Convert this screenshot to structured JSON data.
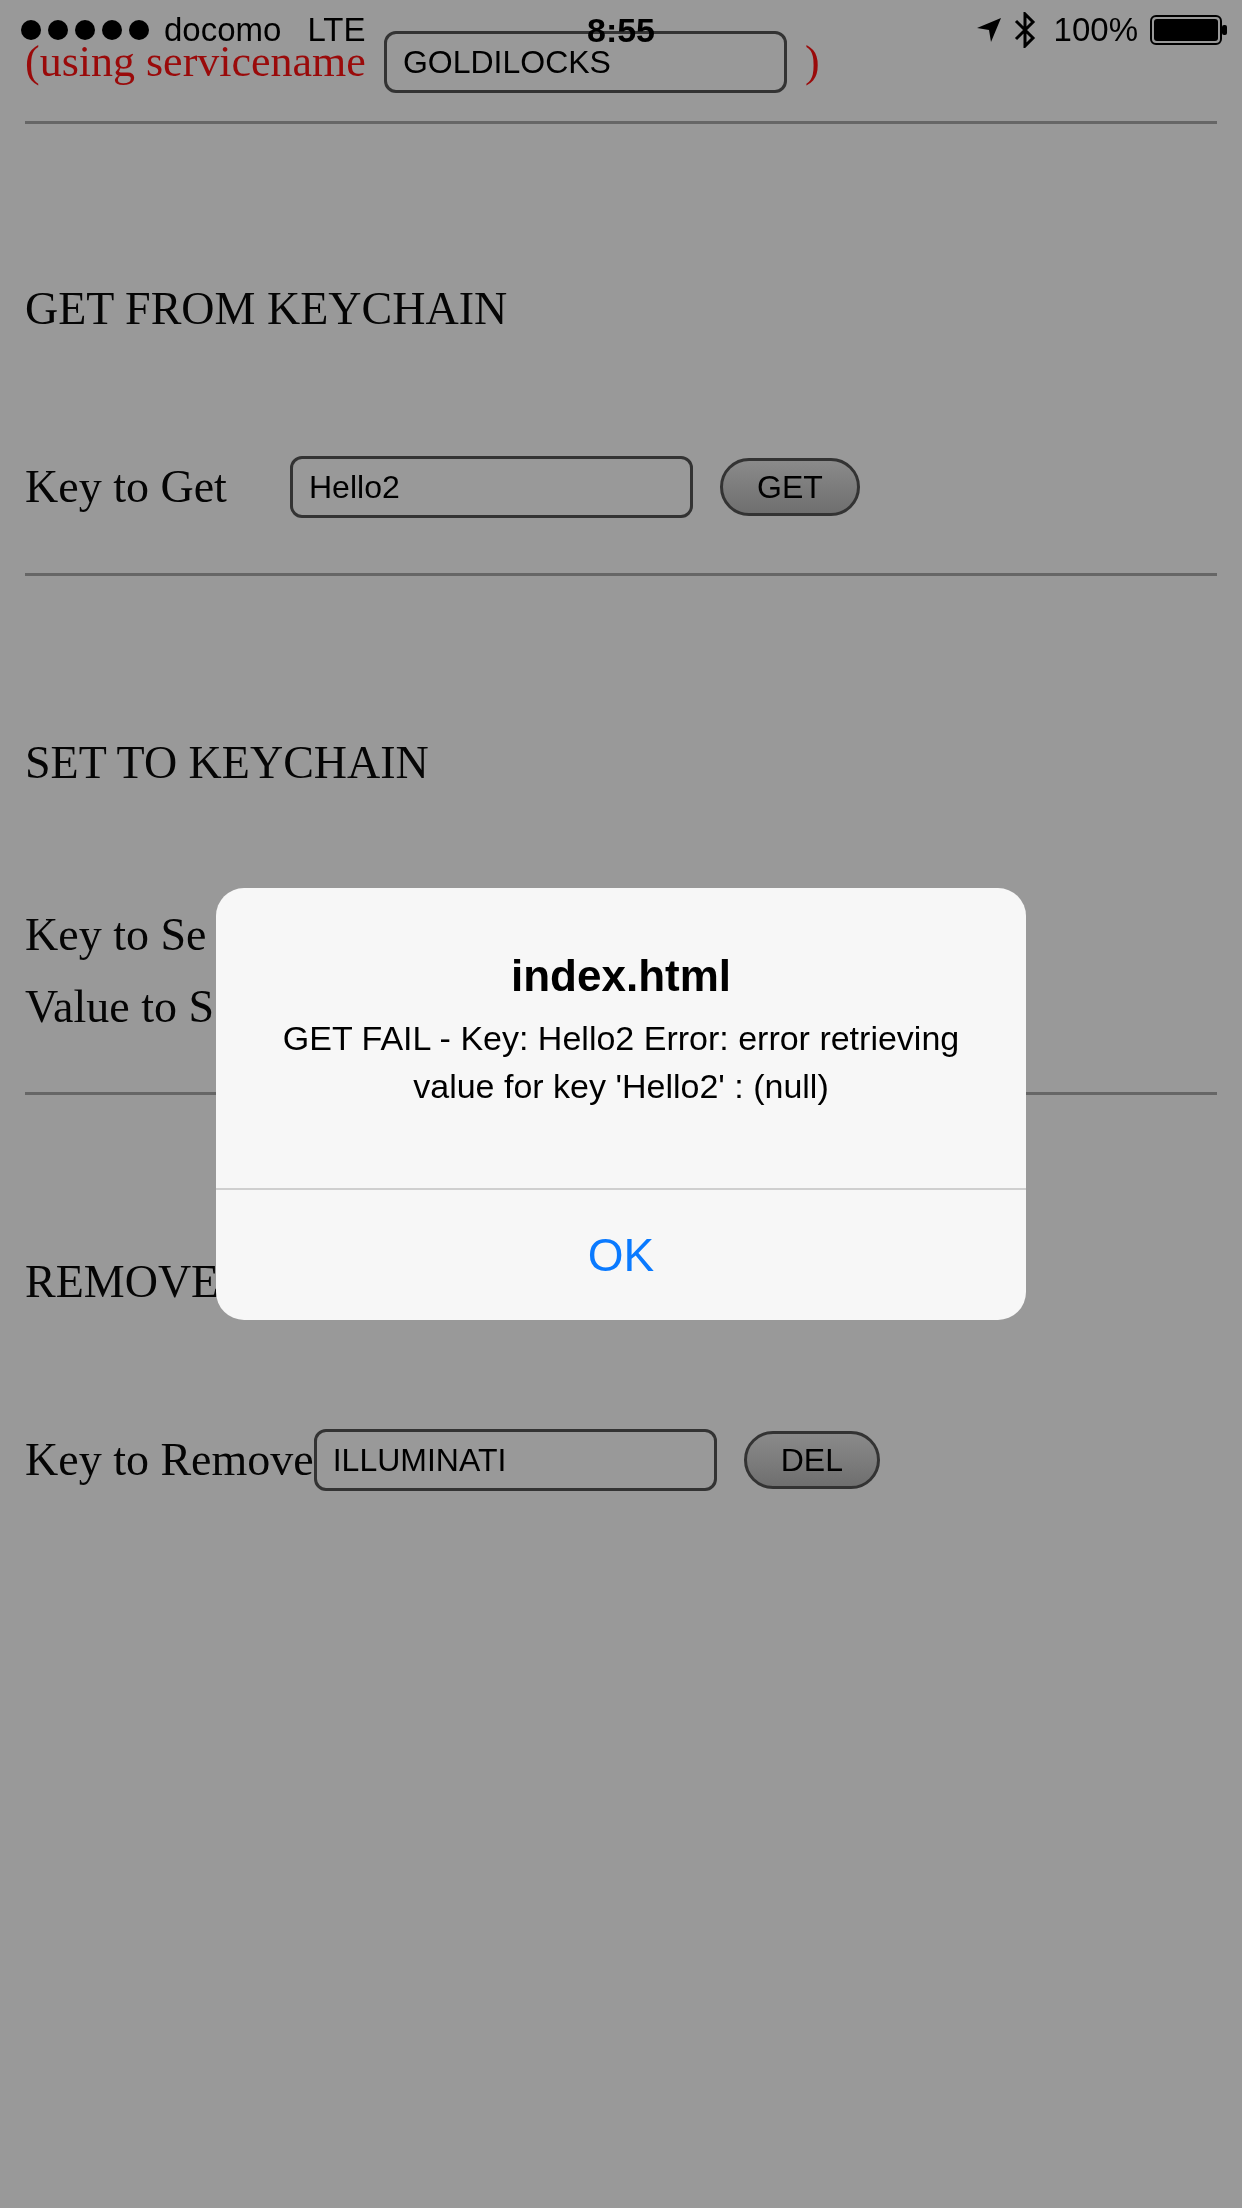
{
  "status_bar": {
    "carrier": "docomo",
    "network": "LTE",
    "time": "8:55",
    "battery": "100%"
  },
  "service": {
    "label": "(using servicename",
    "value": "GOLDILOCKS",
    "close": ")"
  },
  "sections": [
    {
      "heading": "GET FROM KEYCHAIN",
      "rows": [
        {
          "kind": "input",
          "label": "Key to Get",
          "value": "Hello2",
          "button": "GET"
        }
      ]
    },
    {
      "heading": "SET TO KEYCHAIN",
      "rows": [
        {
          "kind": "label",
          "label": "Key to Se"
        },
        {
          "kind": "label",
          "label": "Value to S"
        }
      ]
    },
    {
      "heading": "REMOVE",
      "rows": [
        {
          "kind": "input",
          "label": "Key to Remove",
          "value": "ILLUMINATI",
          "button": "DEL"
        }
      ]
    }
  ],
  "alert": {
    "title": "index.html",
    "message": "GET FAIL - Key: Hello2 Error: error retrieving value for key 'Hello2' : (null)",
    "buttons": [
      "OK"
    ]
  }
}
